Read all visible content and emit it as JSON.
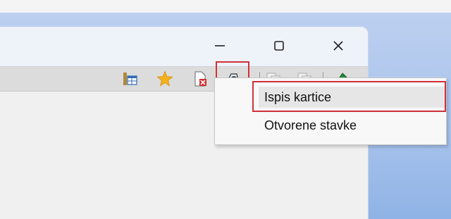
{
  "colors": {
    "highlight": "#d0303a",
    "toolbar": "#dcdcdc",
    "window": "#f0f0f0"
  },
  "window": {
    "controls": [
      {
        "name": "minimize",
        "icon": "minimize-icon"
      },
      {
        "name": "maximize",
        "icon": "maximize-icon"
      },
      {
        "name": "close",
        "icon": "close-icon"
      }
    ]
  },
  "toolbar": {
    "icons": [
      "table-layout-icon",
      "favorite-star-icon",
      "document-delete-icon",
      "print-preview-icon",
      "copy-document-icon",
      "paste-document-icon",
      "export-icon"
    ]
  },
  "dropdown_menu": {
    "items": [
      "Ispis kartice",
      "Otvorene stavke"
    ]
  }
}
